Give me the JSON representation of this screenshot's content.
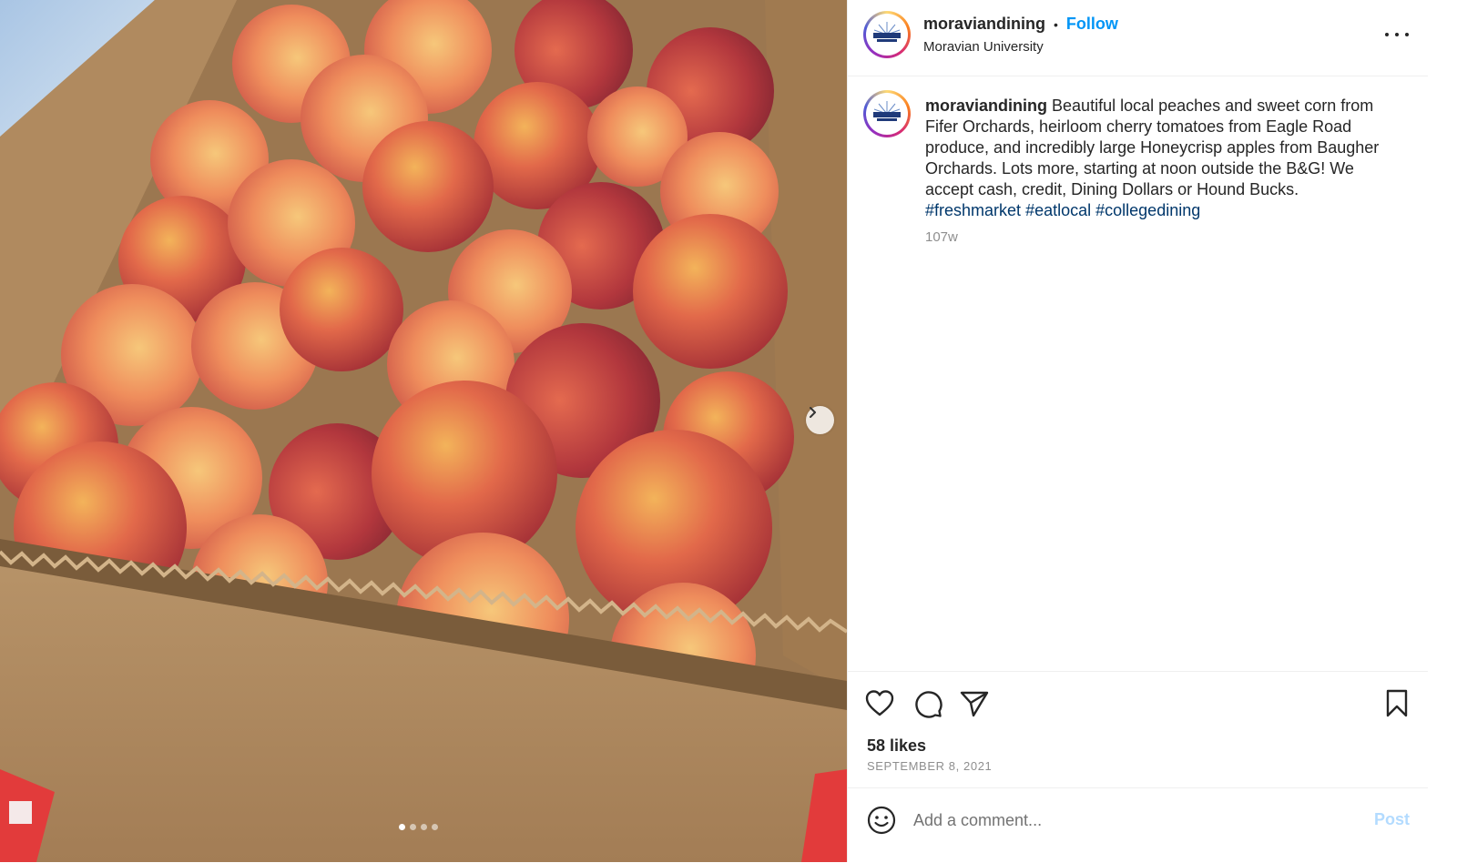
{
  "account": {
    "username": "moraviandining",
    "separator": "•",
    "follow_label": "Follow",
    "location": "Moravian University"
  },
  "caption": {
    "username": "moraviandining",
    "text": "Beautiful local peaches and sweet corn from Fifer Orchards, heirloom cherry tomatoes from Eagle Road produce, and incredibly large Honeycrisp apples from Baugher Orchards. Lots more, starting at noon outside the B&G! We accept cash, credit, Dining Dollars or Hound Bucks.",
    "hashtags": [
      "#freshmarket",
      "#eatlocal",
      "#collegedining"
    ],
    "time_ago": "107w"
  },
  "media": {
    "description_icon": "photo",
    "carousel_count": 4,
    "carousel_index": 1
  },
  "engagement": {
    "likes": "58 likes",
    "date": "SEPTEMBER 8, 2021"
  },
  "comment": {
    "placeholder": "Add a comment...",
    "post_label": "Post"
  },
  "colors": {
    "follow": "#0095f6",
    "hashtag": "#00376b",
    "post_disabled": "#b3dbff"
  }
}
